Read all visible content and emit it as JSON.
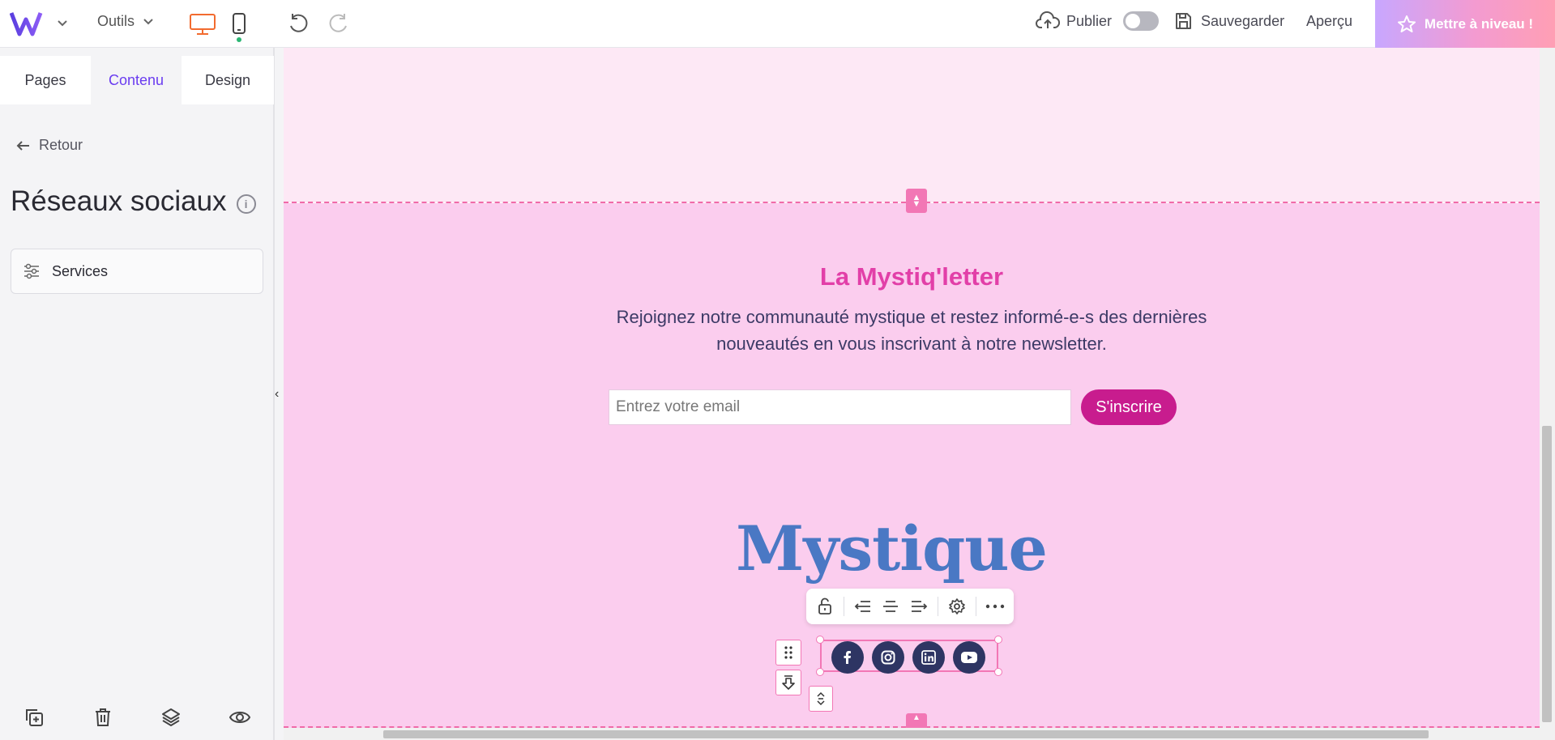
{
  "topbar": {
    "tools_label": "Outils",
    "publish_label": "Publier",
    "save_label": "Sauvegarder",
    "preview_label": "Aperçu",
    "upgrade_label": "Mettre à niveau !",
    "active_device": "desktop",
    "publish_toggle_on": false
  },
  "sidebar": {
    "tabs": [
      {
        "label": "Pages",
        "active": false
      },
      {
        "label": "Contenu",
        "active": true
      },
      {
        "label": "Design",
        "active": false
      }
    ],
    "back_label": "Retour",
    "title": "Réseaux sociaux",
    "items": [
      {
        "label": "Services",
        "icon": "sliders-icon"
      }
    ],
    "bottom_actions": [
      "duplicate-icon",
      "trash-icon",
      "layers-icon",
      "eye-icon"
    ]
  },
  "canvas": {
    "newsletter": {
      "title": "La Mystiq'letter",
      "description": "Rejoignez notre communauté mystique et restez informé-e-s des dernières nouveautés en vous inscrivant à notre newsletter.",
      "email_placeholder": "Entrez votre email",
      "subscribe_label": "S'inscrire"
    },
    "brand": "Mystique",
    "socials": [
      "facebook-icon",
      "instagram-icon",
      "linkedin-icon",
      "youtube-icon"
    ],
    "element_toolbar": [
      "unlock-icon",
      "align-left-icon",
      "align-center-icon",
      "align-right-icon",
      "settings-icon",
      "more-icon"
    ]
  },
  "colors": {
    "accent": "#6a3cf0",
    "section_top_bg": "#fde8f5",
    "section_main_bg": "#fbcdee",
    "newsletter_title": "#e23fa8",
    "subscribe_bg": "#c81c8e",
    "brand_text": "#4a78c4",
    "social_bg": "#2e3563",
    "selection": "#f277b5"
  }
}
